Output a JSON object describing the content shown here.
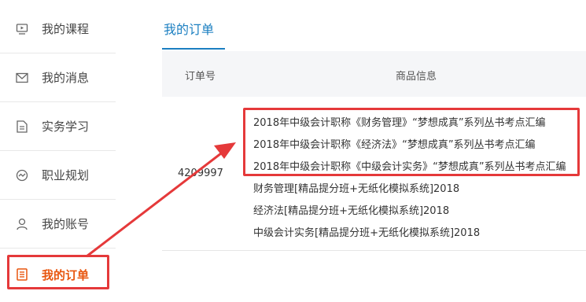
{
  "sidebar": {
    "items": [
      {
        "label": "我的课程",
        "icon": "monitor-icon"
      },
      {
        "label": "我的消息",
        "icon": "envelope-icon"
      },
      {
        "label": "实务学习",
        "icon": "document-icon"
      },
      {
        "label": "职业规划",
        "icon": "trend-circle-icon"
      },
      {
        "label": "我的账号",
        "icon": "user-icon"
      },
      {
        "label": "我的订单",
        "icon": "order-list-icon"
      }
    ]
  },
  "main": {
    "tab": "我的订单",
    "columns": [
      "订单号",
      "商品信息"
    ],
    "order": {
      "number": "4209997",
      "products": [
        "2018年中级会计职称《财务管理》“梦想成真”系列丛书考点汇编",
        "2018年中级会计职称《经济法》“梦想成真”系列丛书考点汇编",
        "2018年中级会计职称《中级会计实务》“梦想成真”系列丛书考点汇编",
        "财务管理[精品提分班+无纸化模拟系统]2018",
        "经济法[精品提分班+无纸化模拟系统]2018",
        "中级会计实务[精品提分班+无纸化模拟系统]2018"
      ]
    }
  },
  "colors": {
    "accent_blue": "#1b7fc1",
    "active_orange": "#e8560f",
    "annotation_red": "#e5393a"
  }
}
